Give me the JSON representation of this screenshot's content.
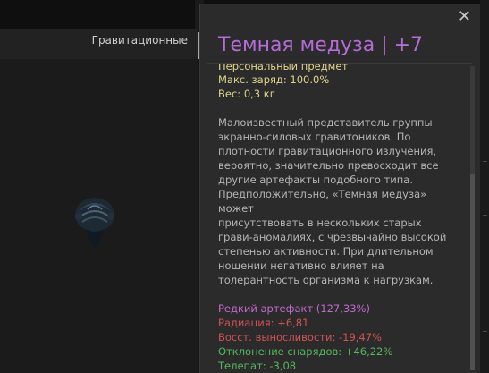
{
  "sidebar": {
    "category_label": "Гравитационные"
  },
  "tooltip": {
    "title": "Темная медуза | +7",
    "close_symbol": "✕",
    "subtitle_partial": "Персональный предмет",
    "stats": {
      "charge": "Макс. заряд: 100.0%",
      "weight": "Вес: 0,3 кг"
    },
    "description": "Малоизвестный представитель группы\nэкранно-силовых гравитоников. По\nплотности гравитационного излучения,\nвероятно, значительно превосходит все\nдругие артефакты подобного типа.\nПредположительно, «Темная медуза» может\nприсутствовать в нескольких старых\nграви-аномалиях, с чрезвычайно высокой\nстепенью активности. При длительном\nношении негативно влияет на\nтолерантность организма к нагрузкам.",
    "rarity": "Редкий артефакт (127,33%)",
    "effects": [
      {
        "text": "Радиация: +6,81",
        "kind": "negative"
      },
      {
        "text": "Восст. выносливости: -19,47%",
        "kind": "negative"
      },
      {
        "text": "Отклонение снарядов: +46,22%",
        "kind": "positive"
      },
      {
        "text": "Телепат: -3,08",
        "kind": "positive"
      }
    ]
  },
  "colors": {
    "title": "#b56cd7",
    "rarity": "#c26ad0",
    "stat": "#e0d68c",
    "negative": "#d25353",
    "positive": "#53b95a"
  }
}
